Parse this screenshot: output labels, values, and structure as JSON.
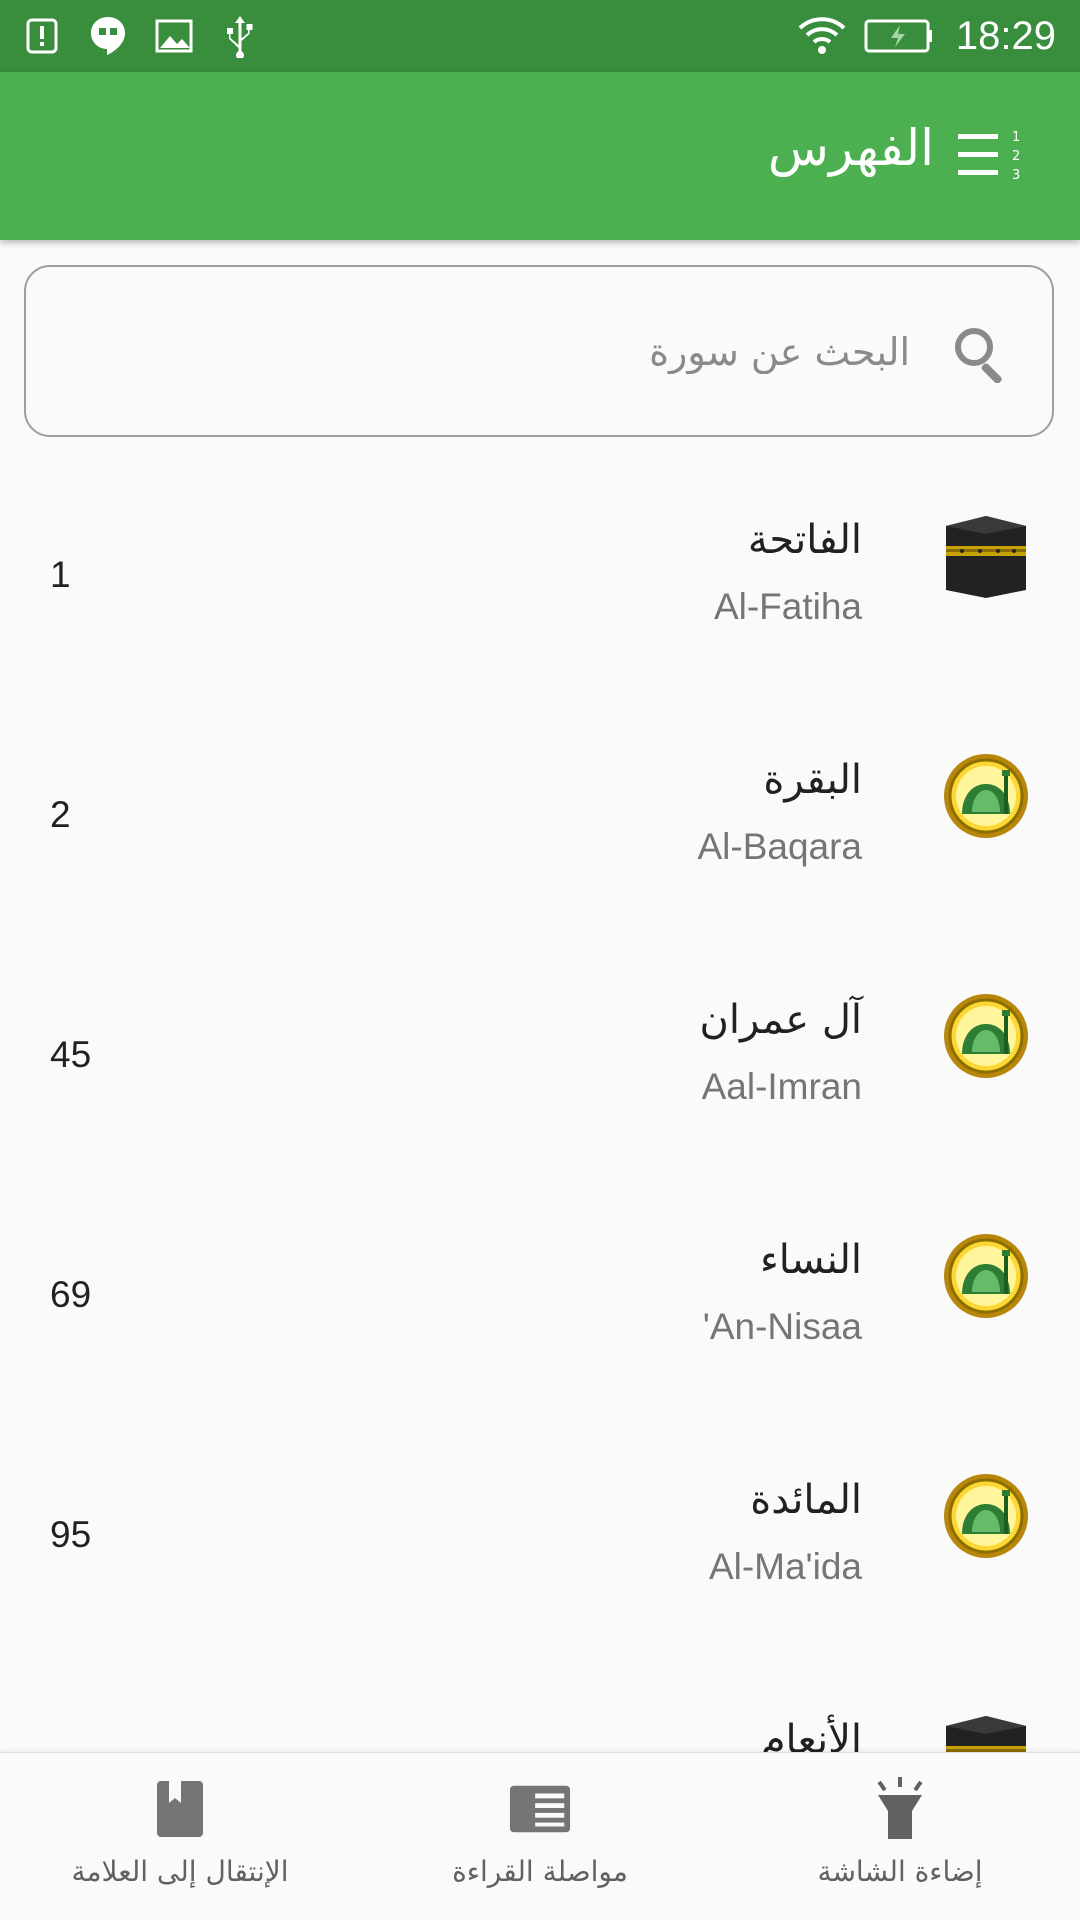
{
  "status_bar": {
    "time": "18:29",
    "icons": [
      "alert-icon",
      "hangouts-icon",
      "image-icon",
      "usb-icon",
      "wifi-icon",
      "battery-charging-icon"
    ]
  },
  "app_bar": {
    "title": "الفهرس",
    "menu_icon": "sort-list-icon"
  },
  "search": {
    "placeholder": "البحث عن سورة",
    "value": "",
    "icon": "search-icon"
  },
  "surahs": [
    {
      "name_ar": "الفاتحة",
      "name_en": "Al-Fatiha",
      "page": "1",
      "emblem": "kaaba-icon"
    },
    {
      "name_ar": "البقرة",
      "name_en": "Al-Baqara",
      "page": "2",
      "emblem": "madina-icon"
    },
    {
      "name_ar": "آل عمران",
      "name_en": "Aal-Imran",
      "page": "45",
      "emblem": "madina-icon"
    },
    {
      "name_ar": "النساء",
      "name_en": "'An-Nisaa",
      "page": "69",
      "emblem": "madina-icon"
    },
    {
      "name_ar": "المائدة",
      "name_en": "Al-Ma'ida",
      "page": "95",
      "emblem": "madina-icon"
    },
    {
      "name_ar": "الأنعام",
      "name_en": "",
      "page": "",
      "emblem": "kaaba-icon"
    }
  ],
  "bottom_nav": {
    "items": [
      {
        "label": "الإنتقال إلى العلامة",
        "icon": "bookmark-icon"
      },
      {
        "label": "مواصلة القراءة",
        "icon": "reading-icon"
      },
      {
        "label": "إضاءة الشاشة",
        "icon": "flashlight-icon"
      }
    ]
  },
  "colors": {
    "status_bar": "#388e3c",
    "app_bar": "#4caf50",
    "background": "#fafafa",
    "primary_text": "#212121",
    "secondary_text": "#757575"
  }
}
